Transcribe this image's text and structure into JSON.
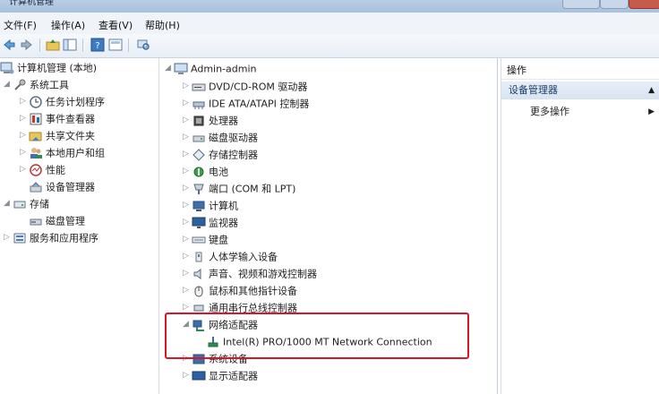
{
  "window": {
    "title": "计算机管理"
  },
  "menu": [
    "文件(F)",
    "操作(A)",
    "查看(V)",
    "帮助(H)"
  ],
  "toolbar": [
    "back-icon",
    "forward-icon",
    "up-folder-icon",
    "console-tree-icon",
    "help-icon",
    "properties-icon",
    "scan-hardware-icon"
  ],
  "left_tree": [
    {
      "label": "计算机管理 (本地)",
      "icon": "computer-management-icon"
    },
    {
      "label": "系统工具",
      "icon": "tools-icon"
    },
    {
      "label": "任务计划程序",
      "icon": "clock-icon"
    },
    {
      "label": "事件查看器",
      "icon": "event-viewer-icon"
    },
    {
      "label": "共享文件夹",
      "icon": "shared-folder-icon"
    },
    {
      "label": "本地用户和组",
      "icon": "users-icon"
    },
    {
      "label": "性能",
      "icon": "performance-icon"
    },
    {
      "label": "设备管理器",
      "icon": "device-manager-icon"
    },
    {
      "label": "存储",
      "icon": "storage-icon"
    },
    {
      "label": "磁盘管理",
      "icon": "disk-management-icon"
    },
    {
      "label": "服务和应用程序",
      "icon": "services-icon"
    }
  ],
  "device_tree": {
    "root": "Admin-admin",
    "categories": [
      {
        "label": "DVD/CD-ROM 驱动器",
        "icon": "dvd-icon"
      },
      {
        "label": "IDE ATA/ATAPI 控制器",
        "icon": "ide-controller-icon"
      },
      {
        "label": "处理器",
        "icon": "processor-icon"
      },
      {
        "label": "磁盘驱动器",
        "icon": "disk-drive-icon"
      },
      {
        "label": "存储控制器",
        "icon": "storage-controller-icon"
      },
      {
        "label": "电池",
        "icon": "battery-icon"
      },
      {
        "label": "端口 (COM 和 LPT)",
        "icon": "port-icon"
      },
      {
        "label": "计算机",
        "icon": "computer-icon"
      },
      {
        "label": "监视器",
        "icon": "monitor-icon"
      },
      {
        "label": "键盘",
        "icon": "keyboard-icon"
      },
      {
        "label": "人体学输入设备",
        "icon": "hid-icon"
      },
      {
        "label": "声音、视频和游戏控制器",
        "icon": "sound-icon"
      },
      {
        "label": "鼠标和其他指针设备",
        "icon": "mouse-icon"
      },
      {
        "label": "通用串行总线控制器",
        "icon": "usb-icon"
      },
      {
        "label": "网络适配器",
        "icon": "network-adapter-icon"
      },
      {
        "label": "Intel(R) PRO/1000 MT Network Connection",
        "icon": "network-card-icon"
      },
      {
        "label": "系统设备",
        "icon": "system-device-icon"
      },
      {
        "label": "显示适配器",
        "icon": "display-adapter-icon"
      }
    ]
  },
  "actions": {
    "header": "操作",
    "section": "设备管理器",
    "more": "更多操作"
  },
  "colors": {
    "highlight_border": "#d8152a",
    "selection_bg": "#d8e3f1"
  }
}
